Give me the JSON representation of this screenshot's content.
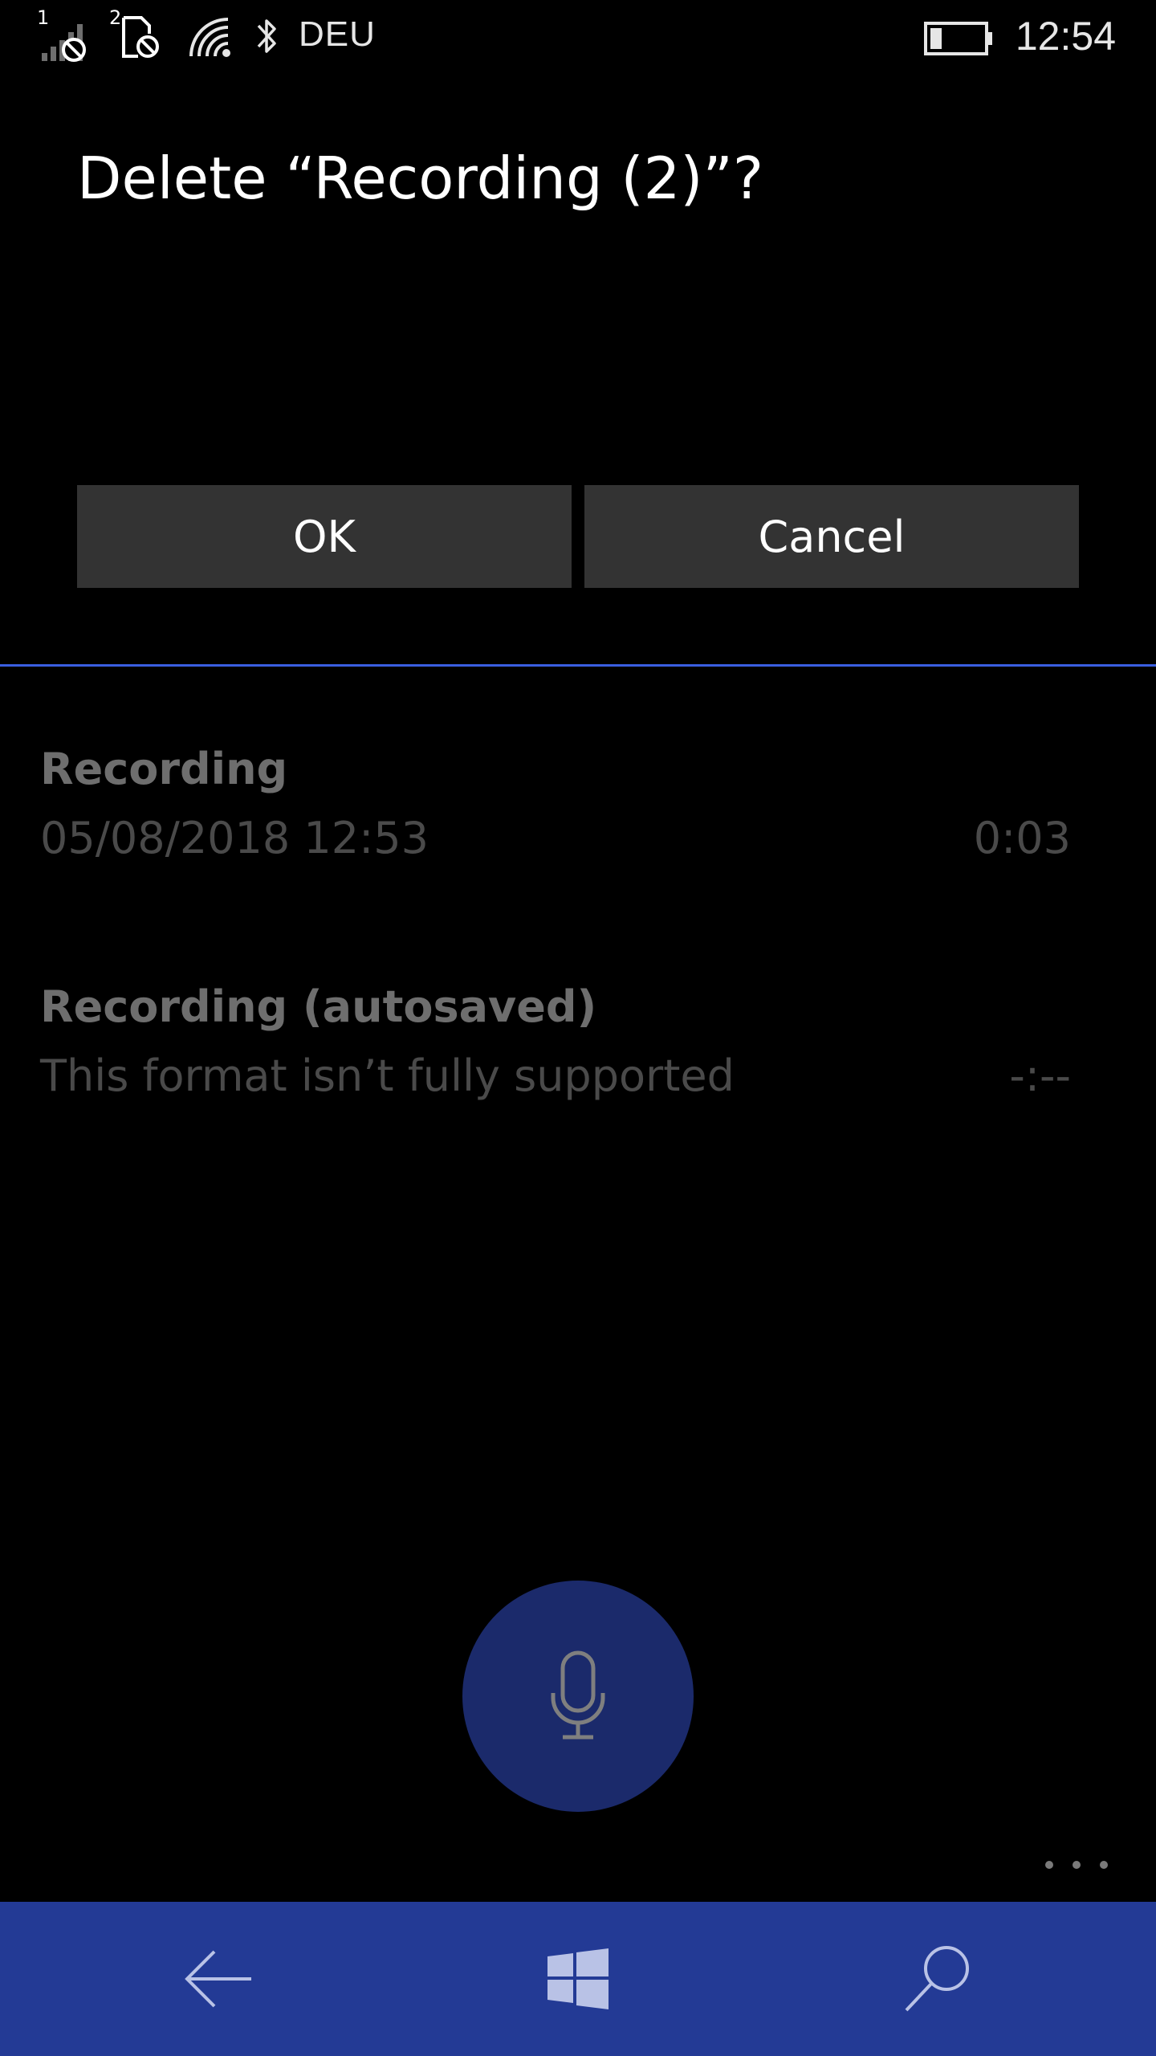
{
  "status_bar": {
    "sim1_label": "1",
    "sim2_label": "2",
    "network": "DEU",
    "time": "12:54"
  },
  "dialog": {
    "title": "Delete “Recording (2)”?",
    "ok_label": "OK",
    "cancel_label": "Cancel"
  },
  "recordings": [
    {
      "title": "Recording",
      "subtitle": "05/08/2018 12:53",
      "duration": "0:03"
    },
    {
      "title": "Recording (autosaved)",
      "subtitle": "This format isn’t fully supported",
      "duration": "-:--"
    }
  ],
  "icons": {
    "record": "microphone-icon",
    "more": "more-icon",
    "back": "back-arrow-icon",
    "home": "windows-logo-icon",
    "search": "search-icon"
  },
  "colors": {
    "accent": "#3a5ee0",
    "nav_bar": "#233a95",
    "mic_button": "#1b2a6b",
    "button_bg": "#333333"
  }
}
